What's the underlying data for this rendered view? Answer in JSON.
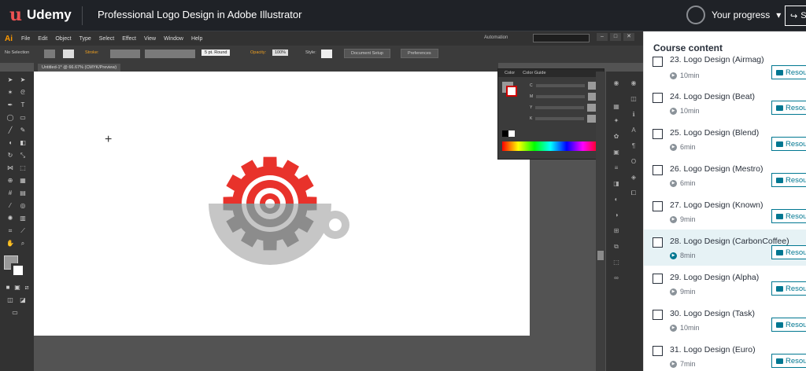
{
  "header": {
    "brand": "Udemy",
    "course_title": "Professional Logo Design in Adobe Illustrator",
    "progress_label": "Your progress",
    "share_label": "S"
  },
  "illustrator": {
    "app_logo": "Ai",
    "menus": [
      "File",
      "Edit",
      "Object",
      "Type",
      "Select",
      "Effect",
      "View",
      "Window",
      "Help"
    ],
    "automation_label": "Automation",
    "control_bar": {
      "selection": "No Selection",
      "stroke_label": "Stroke:",
      "brush": "5 pt. Round",
      "opacity_label": "Opacity:",
      "opacity_value": "100%",
      "style_label": "Style:",
      "document_setup": "Document Setup",
      "preferences": "Preferences"
    },
    "document_tab": "Untitled-1* @ 66.67% (CMYK/Preview)",
    "color_panel": {
      "tabs": [
        "Color",
        "Color Guide"
      ],
      "channels": [
        "C",
        "M",
        "Y",
        "K"
      ],
      "percent": "%"
    }
  },
  "sidebar": {
    "title": "Course content",
    "partial_title": "23. Logo Design (Airmag)",
    "partial_duration": "10min",
    "resources_label": "Resou",
    "lessons": [
      {
        "title": "24. Logo Design (Beat)",
        "duration": "10min"
      },
      {
        "title": "25. Logo Design (Blend)",
        "duration": "6min"
      },
      {
        "title": "26. Logo Design (Mestro)",
        "duration": "6min"
      },
      {
        "title": "27. Logo Design (Known)",
        "duration": "9min"
      },
      {
        "title": "28. Logo Design (CarbonCoffee)",
        "duration": "8min"
      },
      {
        "title": "29. Logo Design (Alpha)",
        "duration": "9min"
      },
      {
        "title": "30. Logo Design (Task)",
        "duration": "10min"
      },
      {
        "title": "31. Logo Design (Euro)",
        "duration": "7min"
      }
    ]
  },
  "colors": {
    "udemy_red": "#ec5252",
    "accent_teal": "#007791",
    "logo_red": "#e8322b",
    "logo_gray_dark": "#8c8c8c",
    "logo_gray_light": "#c6c6c6"
  }
}
